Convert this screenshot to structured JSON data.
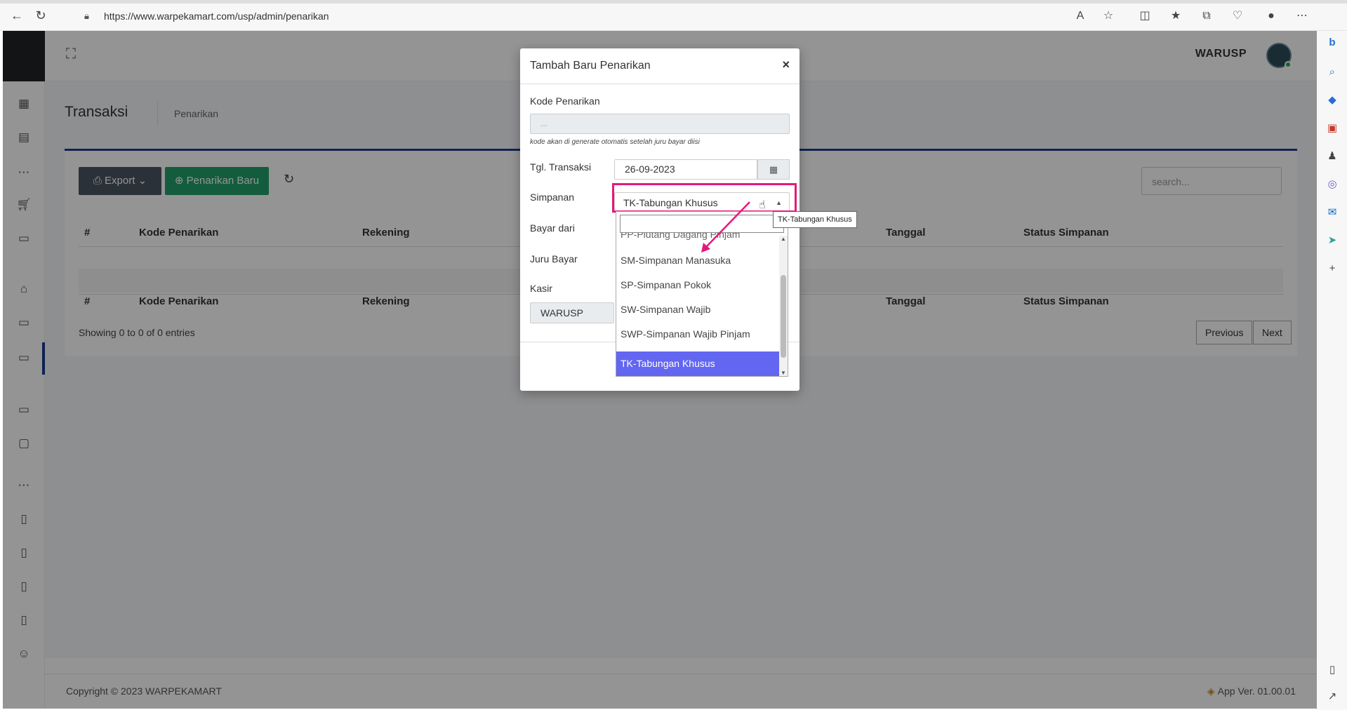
{
  "browser": {
    "url": "https://www.warpekamart.com/usp/admin/penarikan",
    "url_domain": "warpekamart.com"
  },
  "app": {
    "topbar": {
      "user_name": "WARUSP"
    },
    "page": {
      "title": "Transaksi",
      "breadcrumb": "Penarikan"
    },
    "toolbar": {
      "export_label": "Export",
      "new_label": "Penarikan Baru",
      "search_placeholder": "search..."
    },
    "table": {
      "columns": [
        "#",
        "Kode Penarikan",
        "Rekening",
        "Tanggal",
        "Status Simpanan"
      ],
      "footer_columns": [
        "#",
        "Kode Penarikan",
        "Rekening",
        "Tanggal",
        "Status Simpanan"
      ],
      "rows": [],
      "info": "Showing 0 to 0 of 0 entries",
      "pager": {
        "previous": "Previous",
        "next": "Next"
      }
    },
    "footer": {
      "copyright": "Copyright © 2023 WARPEKAMART",
      "version": "App Ver. 01.00.01"
    }
  },
  "modal": {
    "title": "Tambah Baru Penarikan",
    "close": "×",
    "fields": {
      "kode_label": "Kode Penarikan",
      "kode_placeholder": "...",
      "kode_hint": "kode akan di generate otomatis setelah juru bayar diisi",
      "tgl_label": "Tgl. Transaksi",
      "tgl_value": "26-09-2023",
      "simpanan_label": "Simpanan",
      "simpanan_value": "TK-Tabungan Khusus",
      "bayar_label": "Bayar dari",
      "juru_label": "Juru Bayar",
      "kasir_label": "Kasir",
      "kasir_value": "WARUSP"
    }
  },
  "dropdown": {
    "partial_item": "PP-Piutang Dagang Pinjam",
    "options": [
      "SM-Simpanan Manasuka",
      "SP-Simpanan Pokok",
      "SW-Simpanan Wajib",
      "SWP-Simpanan Wajib Pinjam",
      "TK-Tabungan Khusus"
    ],
    "selected": "TK-Tabungan Khusus"
  },
  "tooltip": {
    "text": "TK-Tabungan Khusus"
  },
  "colors": {
    "accent": "#1a3c8f",
    "success": "#22a06b",
    "dark_button": "#4b5563",
    "dropdown_selected": "#6366f1",
    "annotation": "#e4197a"
  }
}
